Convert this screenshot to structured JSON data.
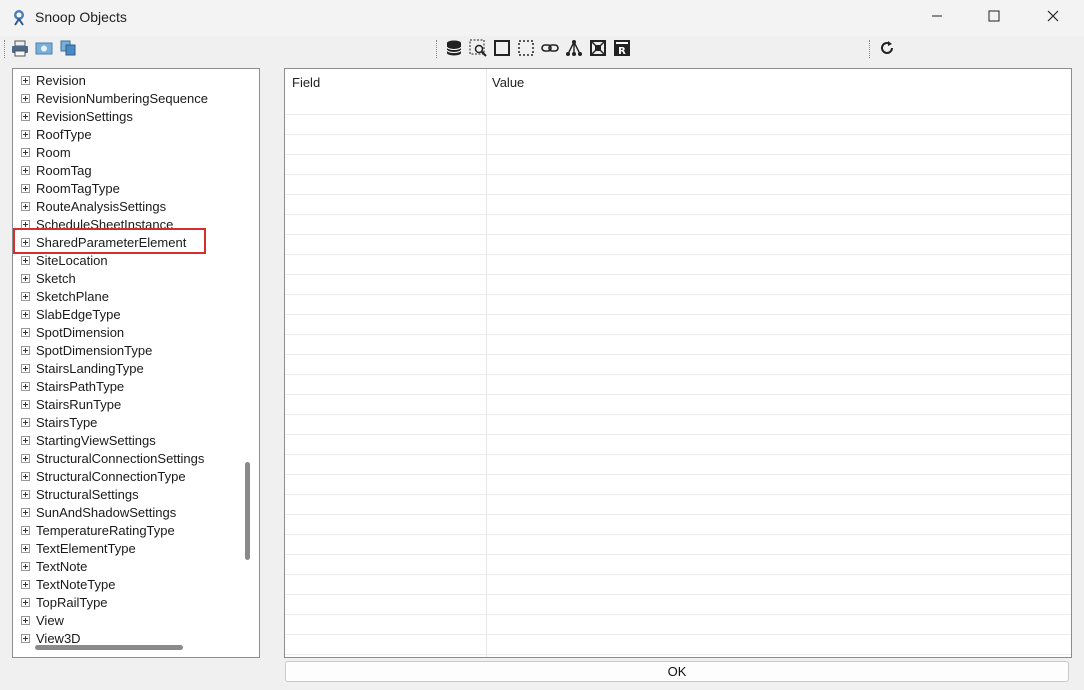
{
  "window": {
    "title": "Snoop Objects",
    "controls": {
      "minimize": "minimize-icon",
      "maximize": "maximize-icon",
      "close": "close-icon"
    }
  },
  "toolbar": {
    "left_icons": [
      "print-icon",
      "print-preview-icon",
      "copy-icon"
    ],
    "center_icons": [
      "database-icon",
      "snoop-selection-icon",
      "select-rectangle-icon",
      "select-dashed-icon",
      "link-icon",
      "dependency-tree-icon",
      "select-element-icon",
      "revit-icon"
    ],
    "right_icons": [
      "refresh-icon"
    ]
  },
  "tree": {
    "items": [
      "Revision",
      "RevisionNumberingSequence",
      "RevisionSettings",
      "RoofType",
      "Room",
      "RoomTag",
      "RoomTagType",
      "RouteAnalysisSettings",
      "ScheduleSheetInstance",
      "SharedParameterElement",
      "SiteLocation",
      "Sketch",
      "SketchPlane",
      "SlabEdgeType",
      "SpotDimension",
      "SpotDimensionType",
      "StairsLandingType",
      "StairsPathType",
      "StairsRunType",
      "StairsType",
      "StartingViewSettings",
      "StructuralConnectionSettings",
      "StructuralConnectionType",
      "StructuralSettings",
      "SunAndShadowSettings",
      "TemperatureRatingType",
      "TextElementType",
      "TextNote",
      "TextNoteType",
      "TopRailType",
      "View",
      "View3D"
    ],
    "highlighted_item": "SharedParameterElement",
    "highlight_color": "#d32f2f"
  },
  "grid": {
    "columns": [
      "Field",
      "Value"
    ]
  },
  "footer": {
    "ok_label": "OK"
  }
}
